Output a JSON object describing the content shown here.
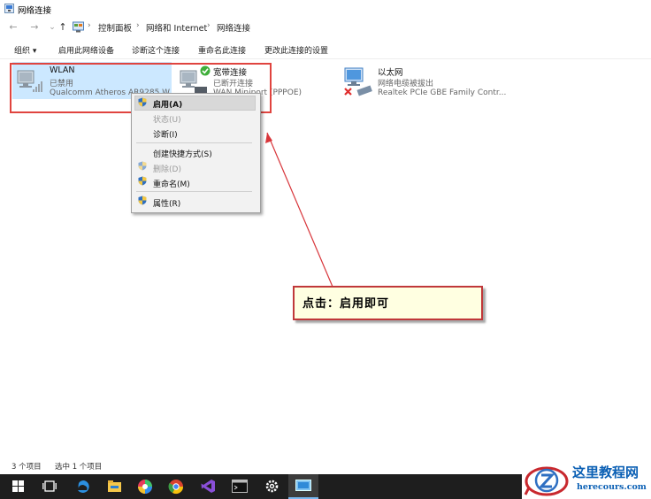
{
  "window": {
    "title": "网络连接"
  },
  "address": {
    "back_glyph": "←",
    "forward_glyph": "→",
    "up_glyph": "↑",
    "crumbs": [
      "控制面板",
      "网络和 Internet",
      "网络连接"
    ],
    "sep": "›"
  },
  "toolbar": {
    "organize": "组织 ▾",
    "enable_device": "启用此网络设备",
    "diagnose": "诊断这个连接",
    "rename": "重命名此连接",
    "change_settings": "更改此连接的设置"
  },
  "connections": [
    {
      "name": "WLAN",
      "status": "已禁用",
      "adapter": "Qualcomm Atheros AR9285 W..."
    },
    {
      "name": "宽带连接",
      "status": "已断开连接",
      "adapter": "WAN Miniport (PPPOE)"
    },
    {
      "name": "以太网",
      "status": "网络电缆被拔出",
      "adapter": "Realtek PCIe GBE Family Contr..."
    }
  ],
  "context_menu": {
    "enable": "启用(A)",
    "status": "状态(U)",
    "diagnose": "诊断(I)",
    "create_shortcut": "创建快捷方式(S)",
    "delete": "删除(D)",
    "rename": "重命名(M)",
    "properties": "属性(R)"
  },
  "callout": {
    "text": "点击：启用即可"
  },
  "statusbar": {
    "item_count": "3 个项目",
    "selected": "选中 1 个项目"
  },
  "watermark": {
    "title": "这里教程网",
    "url": "herecours.com"
  },
  "colors": {
    "accent": "#0078d7",
    "annotation_red": "#e0443f",
    "selection": "#cce8ff"
  }
}
